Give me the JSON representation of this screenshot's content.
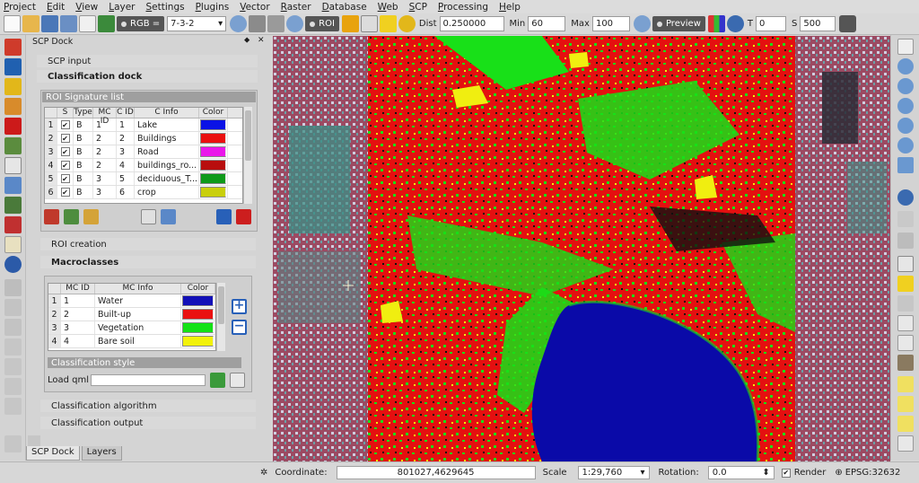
{
  "menu": [
    "Project",
    "Edit",
    "View",
    "Layer",
    "Settings",
    "Plugins",
    "Vector",
    "Raster",
    "Database",
    "Web",
    "SCP",
    "Processing",
    "Help"
  ],
  "toolbar": {
    "rgb_label": "RGB =",
    "rgb_value": "7-3-2",
    "roi_label": "ROI",
    "dist_label": "Dist",
    "dist_value": "0.250000",
    "min_label": "Min",
    "min_value": "60",
    "max_label": "Max",
    "max_value": "100",
    "preview_label": "Preview",
    "t_label": "T",
    "t_value": "0",
    "s_label": "S",
    "s_value": "500"
  },
  "dock": {
    "title": "SCP Dock",
    "scp_input": "SCP input",
    "classification_dock": "Classification dock",
    "roi_signature_list": {
      "title": "ROI Signature list",
      "columns": [
        "S",
        "Type",
        "MC ID",
        "C ID",
        "C Info",
        "Color"
      ],
      "rows": [
        {
          "n": "1",
          "type": "B",
          "mc": "1",
          "c": "1",
          "info": "Lake",
          "color": "#0a12e6"
        },
        {
          "n": "2",
          "type": "B",
          "mc": "2",
          "c": "2",
          "info": "Buildings",
          "color": "#ea1010"
        },
        {
          "n": "3",
          "type": "B",
          "mc": "2",
          "c": "3",
          "info": "Road",
          "color": "#ea16ea"
        },
        {
          "n": "4",
          "type": "B",
          "mc": "2",
          "c": "4",
          "info": "buildings_ro...",
          "color": "#b80d0d"
        },
        {
          "n": "5",
          "type": "B",
          "mc": "3",
          "c": "5",
          "info": "deciduous_T...",
          "color": "#0e9a1a"
        },
        {
          "n": "6",
          "type": "B",
          "mc": "3",
          "c": "6",
          "info": "crop",
          "color": "#c9cf0c"
        }
      ]
    },
    "roi_creation": "ROI creation",
    "macroclasses": {
      "title": "Macroclasses",
      "columns": [
        "MC ID",
        "MC Info",
        "Color"
      ],
      "rows": [
        {
          "n": "1",
          "id": "1",
          "info": "Water",
          "color": "#1210b8"
        },
        {
          "n": "2",
          "id": "2",
          "info": "Built-up",
          "color": "#ea1010"
        },
        {
          "n": "3",
          "id": "3",
          "info": "Vegetation",
          "color": "#14e214"
        },
        {
          "n": "4",
          "id": "4",
          "info": "Bare soil",
          "color": "#f2f20a"
        }
      ]
    },
    "classification_style": "Classification style",
    "load_qml": "Load qml",
    "classification_algorithm": "Classification algorithm",
    "classification_output": "Classification output",
    "tabs": [
      "SCP Dock",
      "Layers"
    ]
  },
  "status": {
    "coordinate_label": "Coordinate:",
    "coordinate_value": "801027,4629645",
    "scale_label": "Scale",
    "scale_value": "1:29,760",
    "rotation_label": "Rotation:",
    "rotation_value": "0.0",
    "render_label": "Render",
    "epsg": "EPSG:32632"
  },
  "colors": {
    "water": "#0a0aa8",
    "builtup": "#e41010",
    "vegetation": "#18e018",
    "bare": "#f0ee10"
  },
  "icons": {
    "crosshair": "crosshair-icon"
  }
}
